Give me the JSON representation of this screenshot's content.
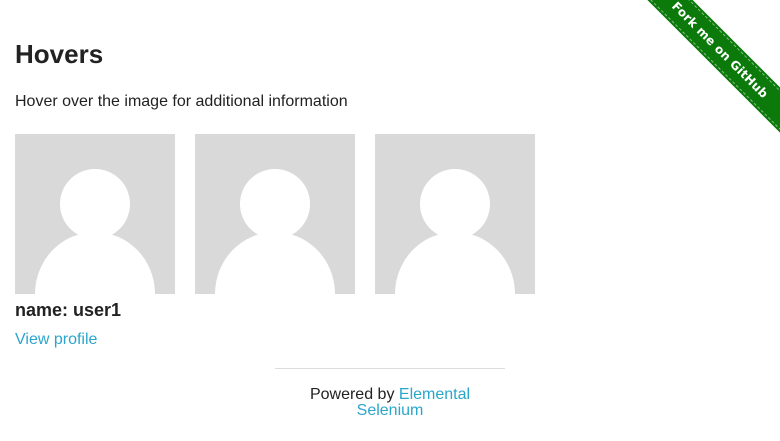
{
  "page": {
    "title": "Hovers",
    "subtitle": "Hover over the image for additional information"
  },
  "figures": [
    {
      "name": "name: user1",
      "link_label": "View profile",
      "icon": "user-avatar-icon"
    },
    {
      "icon": "user-avatar-icon"
    },
    {
      "icon": "user-avatar-icon"
    }
  ],
  "footer": {
    "prefix": "Powered by ",
    "link_line1": "Elemental",
    "link_line2": "Selenium"
  },
  "ribbon": {
    "label": "Fork me on GitHub",
    "color": "#0b7a0b"
  },
  "colors": {
    "link": "#2ba6cb",
    "avatar_bg": "#d9d9d9",
    "avatar_fg": "#ffffff"
  }
}
